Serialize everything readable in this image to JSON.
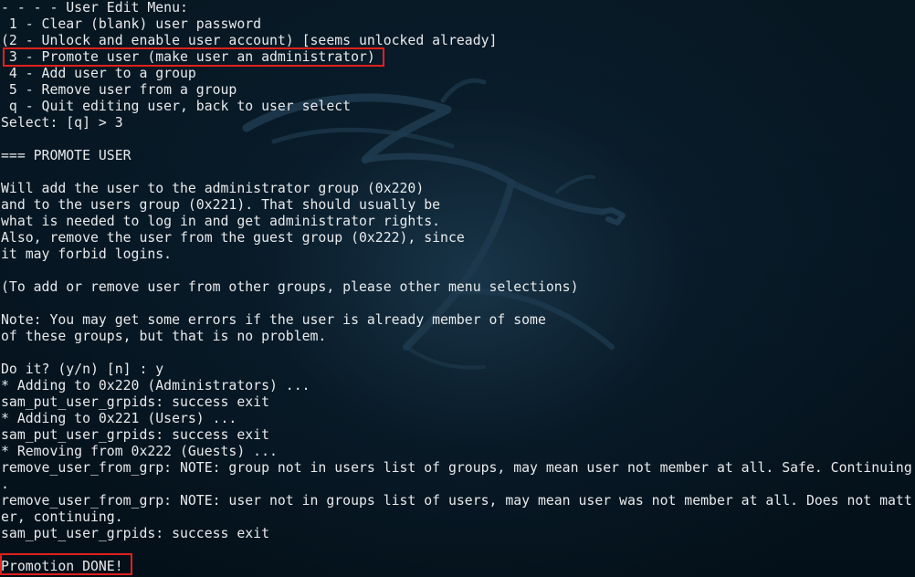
{
  "terminal": {
    "lines": [
      "- - - - User Edit Menu:",
      " 1 - Clear (blank) user password",
      "(2 - Unlock and enable user account) [seems unlocked already]",
      " 3 - Promote user (make user an administrator)",
      " 4 - Add user to a group",
      " 5 - Remove user from a group",
      " q - Quit editing user, back to user select",
      "Select: [q] > 3",
      "",
      "=== PROMOTE USER",
      "",
      "Will add the user to the administrator group (0x220)",
      "and to the users group (0x221). That should usually be",
      "what is needed to log in and get administrator rights.",
      "Also, remove the user from the guest group (0x222), since",
      "it may forbid logins.",
      "",
      "(To add or remove user from other groups, please other menu selections)",
      "",
      "Note: You may get some errors if the user is already member of some",
      "of these groups, but that is no problem.",
      "",
      "Do it? (y/n) [n] : y",
      "* Adding to 0x220 (Administrators) ...",
      "sam_put_user_grpids: success exit",
      "* Adding to 0x221 (Users) ...",
      "sam_put_user_grpids: success exit",
      "* Removing from 0x222 (Guests) ...",
      "remove_user_from_grp: NOTE: group not in users list of groups, may mean user not member at all. Safe. Continuing",
      ".",
      "remove_user_from_grp: NOTE: user not in groups list of users, may mean user was not member at all. Does not matt",
      "er, continuing.",
      "sam_put_user_grpids: success exit",
      "",
      "Promotion DONE!"
    ]
  },
  "colors": {
    "text": "#e8eaec",
    "highlight_box": "#e0201c",
    "background": "#04121c"
  },
  "decor": {
    "wallpaper": "kali-dragon-logo"
  }
}
